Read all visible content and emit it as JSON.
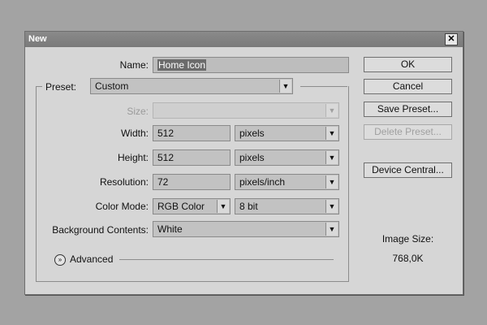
{
  "window": {
    "title": "New",
    "close_glyph": "✕"
  },
  "form": {
    "name_label": "Name:",
    "name_value": "Home Icon",
    "preset_label": "Preset:",
    "preset_value": "Custom",
    "size_label": "Size:",
    "size_value": "",
    "width_label": "Width:",
    "width_value": "512",
    "width_unit": "pixels",
    "height_label": "Height:",
    "height_value": "512",
    "height_unit": "pixels",
    "resolution_label": "Resolution:",
    "resolution_value": "72",
    "resolution_unit": "pixels/inch",
    "color_mode_label": "Color Mode:",
    "color_mode_value": "RGB Color",
    "bit_depth_value": "8 bit",
    "background_label": "Background Contents:",
    "background_value": "White",
    "advanced_label": "Advanced"
  },
  "buttons": {
    "ok": "OK",
    "cancel": "Cancel",
    "save_preset": "Save Preset...",
    "delete_preset": "Delete Preset...",
    "device_central": "Device Central..."
  },
  "image_size": {
    "label": "Image Size:",
    "value": "768,0K"
  },
  "icons": {
    "dropdown": "chevron-down-icon",
    "advanced": "double-chevron-down-icon",
    "close": "close-icon"
  }
}
